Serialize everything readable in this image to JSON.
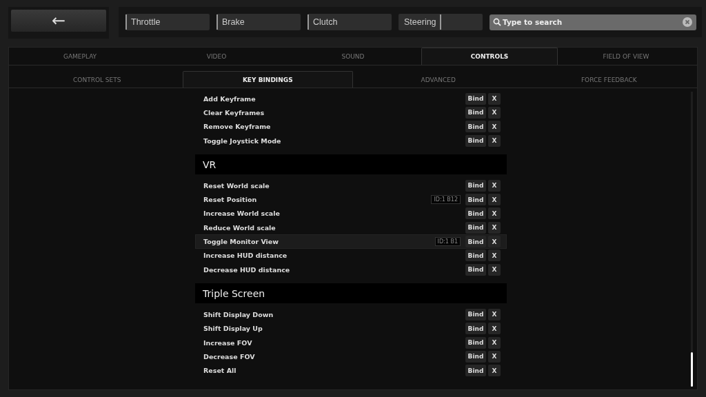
{
  "back_button": {
    "label": "←"
  },
  "axes": [
    {
      "label": "Throttle",
      "level": 0
    },
    {
      "label": "Brake",
      "level": 0
    },
    {
      "label": "Clutch",
      "level": 0
    },
    {
      "label": "Steering",
      "level": 0.5
    }
  ],
  "search": {
    "placeholder": "Type to search"
  },
  "tabs": [
    {
      "label": "GAMEPLAY",
      "selected": false
    },
    {
      "label": "VIDEO",
      "selected": false
    },
    {
      "label": "SOUND",
      "selected": false
    },
    {
      "label": "CONTROLS",
      "selected": true
    },
    {
      "label": "FIELD OF VIEW",
      "selected": false
    }
  ],
  "subtabs": [
    {
      "label": "CONTROL SETS",
      "selected": false
    },
    {
      "label": "KEY BINDINGS",
      "selected": true
    },
    {
      "label": "ADVANCED",
      "selected": false
    },
    {
      "label": "FORCE FEEDBACK",
      "selected": false
    }
  ],
  "sections": [
    {
      "rows": [
        {
          "label": "Add Keyframe",
          "bind": "Bind",
          "clear": "X",
          "highlighted": false
        },
        {
          "label": "Clear Keyframes",
          "bind": "Bind",
          "clear": "X",
          "highlighted": false
        },
        {
          "label": "Remove Keyframe",
          "bind": "Bind",
          "clear": "X",
          "highlighted": false
        },
        {
          "label": "Toggle Joystick Mode",
          "bind": "Bind",
          "clear": "X",
          "highlighted": false
        }
      ]
    },
    {
      "title": "VR",
      "rows": [
        {
          "label": "Reset World scale",
          "bind": "Bind",
          "clear": "X",
          "highlighted": false
        },
        {
          "label": "Reset Position",
          "binding": "ID:1 B12",
          "bind": "Bind",
          "clear": "X",
          "highlighted": false
        },
        {
          "label": "Increase World scale",
          "bind": "Bind",
          "clear": "X",
          "highlighted": false
        },
        {
          "label": "Reduce World scale",
          "bind": "Bind",
          "clear": "X",
          "highlighted": false
        },
        {
          "label": "Toggle Monitor View",
          "binding": "ID:1 B1",
          "bind": "Bind",
          "clear": "X",
          "highlighted": true
        },
        {
          "label": "Increase HUD distance",
          "bind": "Bind",
          "clear": "X",
          "highlighted": false
        },
        {
          "label": "Decrease HUD distance",
          "bind": "Bind",
          "clear": "X",
          "highlighted": false
        }
      ]
    },
    {
      "title": "Triple Screen",
      "rows": [
        {
          "label": "Shift Display Down",
          "bind": "Bind",
          "clear": "X",
          "highlighted": false
        },
        {
          "label": "Shift Display Up",
          "bind": "Bind",
          "clear": "X",
          "highlighted": false
        },
        {
          "label": "Increase FOV",
          "bind": "Bind",
          "clear": "X",
          "highlighted": false
        },
        {
          "label": "Decrease FOV",
          "bind": "Bind",
          "clear": "X",
          "highlighted": false
        },
        {
          "label": "Reset All",
          "bind": "Bind",
          "clear": "X",
          "highlighted": false
        }
      ]
    }
  ]
}
